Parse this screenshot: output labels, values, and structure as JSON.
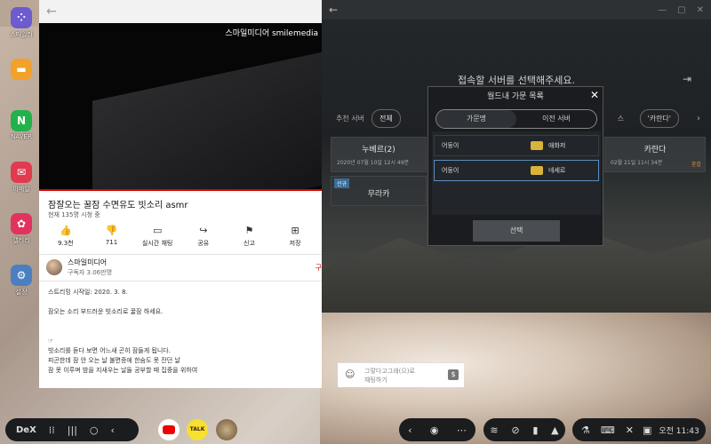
{
  "dock": [
    {
      "label": "스마일러",
      "icon": "apps-icon",
      "color": "#6d5bd0"
    },
    {
      "label": "",
      "icon": "folder-icon",
      "color": "#f2a12b"
    },
    {
      "label": "NAVER",
      "icon": "naver-icon",
      "color": "#22b24c"
    },
    {
      "label": "이메일",
      "icon": "email-icon",
      "color": "#e03b4f"
    },
    {
      "label": "갤러리",
      "icon": "flower-icon",
      "color": "#e2335f"
    },
    {
      "label": "설정",
      "icon": "gear-icon",
      "color": "#4b7fc0"
    }
  ],
  "youtube": {
    "watermark": "스마일미디어 smilemedia",
    "title": "잠잘오는 꿀잠 수면유도 빗소리 asmr",
    "views": "현재 135명 시청 중",
    "actions": [
      {
        "label": "9.3천",
        "icon": "like-icon"
      },
      {
        "label": "711",
        "icon": "dislike-icon"
      },
      {
        "label": "실시간 채팅",
        "icon": "chat-icon"
      },
      {
        "label": "공유",
        "icon": "share-icon"
      },
      {
        "label": "신고",
        "icon": "flag-icon"
      },
      {
        "label": "저장",
        "icon": "save-icon"
      }
    ],
    "channel": {
      "name": "스마일미디어",
      "subs": "구독자 3.06만명",
      "subscribe": "구"
    },
    "description": [
      "스트리밍 시작일: 2020. 3. 8.",
      "",
      "잠오는 소리 부드러운 빗소리로 꿀잠 하세요.",
      "",
      "",
      "☞",
      "빗소리를 듣다 보면 어느새 곤히 잠들게 됩니다.",
      "피곤한데 잠 안 오는 날 불면증에 한숨도 못 잔던 날",
      "잠 못 이루며 밤을 지새우는 날들 공부할 때 집중을 위하여"
    ]
  },
  "chat": {
    "placeholder_line1": "그랗다고그래(으)로",
    "placeholder_line2": "채팅하기"
  },
  "game": {
    "heading": "접속할 서버를 선택해주세요.",
    "tabs": [
      "추천 서버",
      "전체",
      "'카란다'"
    ],
    "tab_suffix": "스",
    "servers": [
      {
        "name": "누베르(2)",
        "date": "2020년 07월 10일 12시 49분"
      },
      {
        "name": "카란다",
        "date": "02월 21일 11시 34분",
        "badge": "혼잡"
      }
    ],
    "new_tag": "신규",
    "server_row2": "무라카",
    "modal": {
      "title": "월드내 가문 목록",
      "tabs": [
        "가문명",
        "이전 서버"
      ],
      "rows": [
        {
          "family": "어둥이",
          "server": "애화저"
        },
        {
          "family": "어둥이",
          "server": "네세르"
        }
      ],
      "select": "선택"
    }
  },
  "taskbar": {
    "dex": "DeX",
    "time": "오전 11:43"
  }
}
